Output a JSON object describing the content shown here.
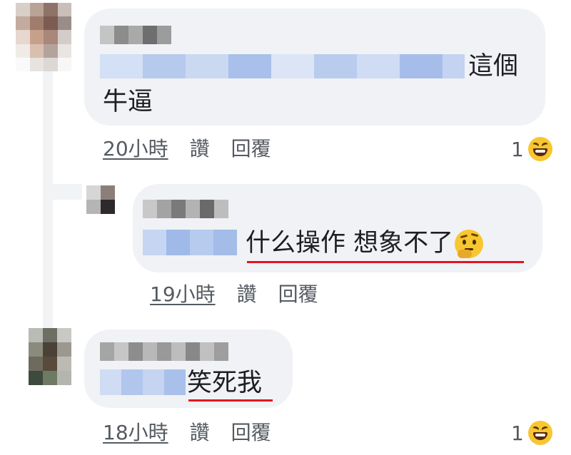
{
  "colors": {
    "bubble": "#f0f2f5",
    "underline": "#e4141e",
    "meta_text": "#555a61"
  },
  "comments": [
    {
      "author": "",
      "text_line1": "這個",
      "text_line2": "牛逼",
      "time": "20小時",
      "like_label": "讚",
      "reply_label": "回覆",
      "reaction_count": "1",
      "reaction_icon": "laugh-emoji-icon"
    },
    {
      "author": "",
      "text": "什么操作 想象不了",
      "emoji": "thinking-emoji-icon",
      "time": "19小時",
      "like_label": "讚",
      "reply_label": "回覆"
    },
    {
      "author": "",
      "text": "笑死我",
      "time": "18小時",
      "like_label": "讚",
      "reply_label": "回覆",
      "reaction_count": "1",
      "reaction_icon": "laugh-emoji-icon"
    }
  ]
}
